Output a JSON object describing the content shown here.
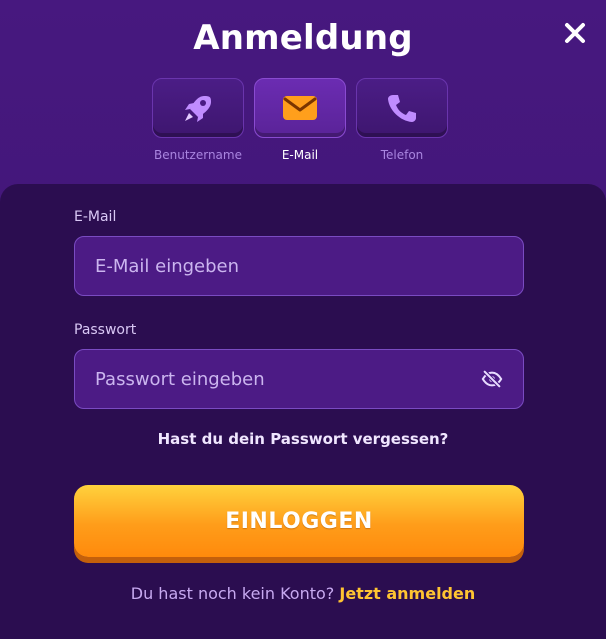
{
  "modal": {
    "title": "Anmeldung"
  },
  "tabs": [
    {
      "label": "Benutzername",
      "icon": "rocket-icon"
    },
    {
      "label": "E-Mail",
      "icon": "envelope-icon",
      "active": true
    },
    {
      "label": "Telefon",
      "icon": "phone-icon"
    }
  ],
  "form": {
    "email_label": "E-Mail",
    "email_placeholder": "E-Mail eingeben",
    "password_label": "Passwort",
    "password_placeholder": "Passwort eingeben",
    "forgot_label": "Hast du dein Passwort vergessen?",
    "login_label": "EINLOGGEN",
    "signup_text": "Du hast noch kein Konto?",
    "signup_link": "Jetzt anmelden"
  },
  "colors": {
    "accent_orange": "#ff9d1a",
    "link_yellow": "#ffc431",
    "panel": "#2b0d50",
    "background": "#47187f"
  }
}
